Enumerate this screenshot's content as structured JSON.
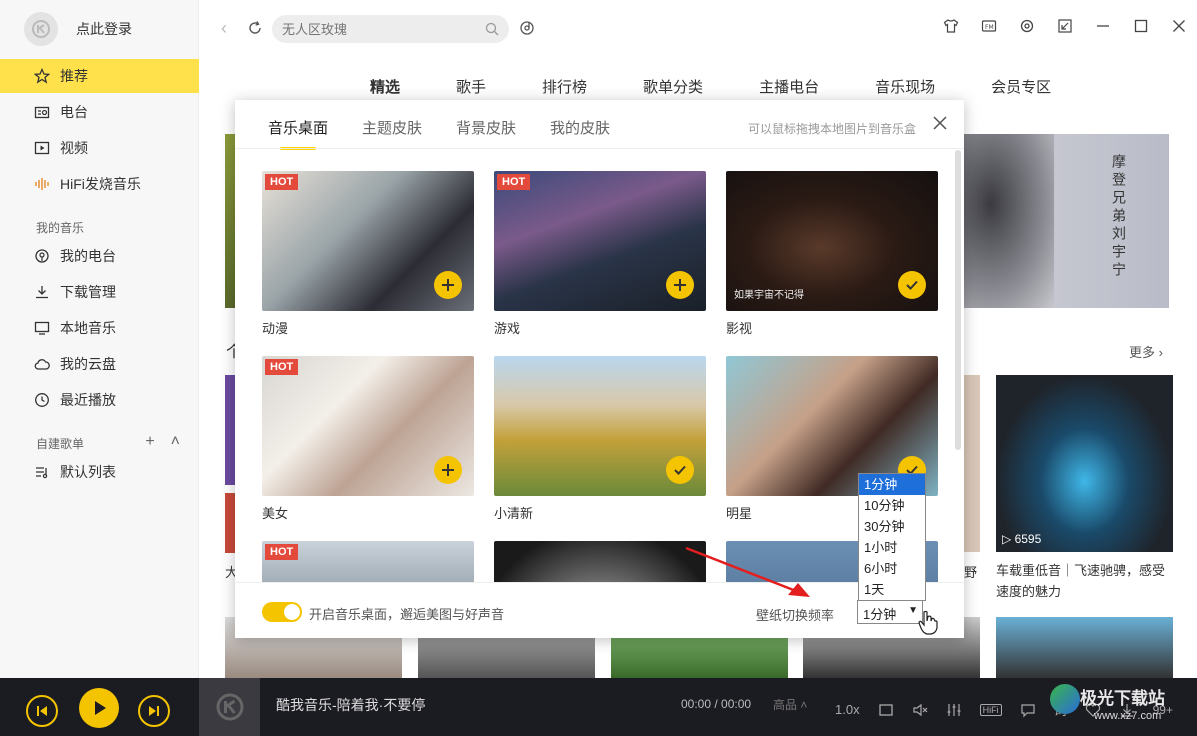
{
  "sidebar": {
    "login_text": "点此登录",
    "items": [
      {
        "label": "推荐",
        "active": true
      },
      {
        "label": "电台"
      },
      {
        "label": "视频"
      },
      {
        "label": "HiFi发烧音乐"
      }
    ],
    "my_music_title": "我的音乐",
    "my_items": [
      {
        "label": "我的电台"
      },
      {
        "label": "下载管理"
      },
      {
        "label": "本地音乐"
      },
      {
        "label": "我的云盘"
      },
      {
        "label": "最近播放"
      }
    ],
    "playlist_title": "自建歌单",
    "playlist_items": [
      {
        "label": "默认列表"
      }
    ]
  },
  "search": {
    "placeholder": "无人区玫瑰"
  },
  "tabs": [
    "精选",
    "歌手",
    "排行榜",
    "歌单分类",
    "主播电台",
    "音乐现场",
    "会员专区"
  ],
  "background": {
    "banner_text": "摩登兄弟刘宇宁",
    "more": "更多 ›",
    "car_plays": "▷ 6595",
    "car_title": "车载重低音｜飞速驰骋，感受速度的魅力",
    "strip_text": "野",
    "left_text": "大",
    "section_mark": "个"
  },
  "modal": {
    "tabs": [
      "音乐桌面",
      "主题皮肤",
      "背景皮肤",
      "我的皮肤"
    ],
    "hint": "可以鼠标拖拽本地图片到音乐盒",
    "hot_label": "HOT",
    "tiles": [
      {
        "label": "动漫",
        "hot": true,
        "action": "add"
      },
      {
        "label": "游戏",
        "hot": true,
        "action": "add"
      },
      {
        "label": "影视",
        "hot": false,
        "action": "check",
        "overlay": "如果宇宙不记得"
      },
      {
        "label": "美女",
        "hot": true,
        "action": "add"
      },
      {
        "label": "小清新",
        "hot": false,
        "action": "check"
      },
      {
        "label": "明星",
        "hot": false,
        "action": "check"
      },
      {
        "label": "",
        "hot": true
      },
      {
        "label": "",
        "hot": false
      },
      {
        "label": "",
        "hot": false
      }
    ],
    "toggle_label": "开启音乐桌面，邂逅美图与好声音",
    "freq_label": "壁纸切换频率",
    "freq_selected": "1分钟",
    "freq_options": [
      "1分钟",
      "10分钟",
      "30分钟",
      "1小时",
      "6小时",
      "1天"
    ]
  },
  "player": {
    "song": "酷我音乐-陪着我·不要停",
    "time": "00:00 / 00:00",
    "quality": "高品 ˄",
    "speed": "1.0x",
    "hifi": "HiFi",
    "lyric": "词",
    "count": "99+"
  },
  "watermark": {
    "line1": "极光下载站",
    "line2": "www.xz7.com"
  }
}
